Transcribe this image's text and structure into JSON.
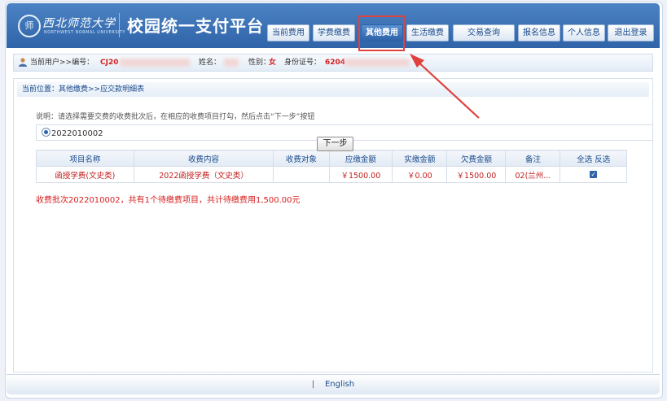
{
  "header": {
    "seal_char": "师",
    "school_name": "西北师范大学",
    "school_name_en": "NORTHWEST NORMAL UNIVERSITY",
    "system_title": "校园统一支付平台",
    "nav": [
      {
        "label": "当前费用",
        "active": false
      },
      {
        "label": "学费缴费",
        "active": false
      },
      {
        "label": "其他费用",
        "active": true
      },
      {
        "label": "生活缴费",
        "active": false
      },
      {
        "label": "交易查询",
        "active": false
      },
      {
        "label": "报名信息",
        "active": false
      },
      {
        "label": "个人信息",
        "active": false
      },
      {
        "label": "退出登录",
        "active": false
      }
    ]
  },
  "user_bar": {
    "prefix": "当前用户>>编号：",
    "id_value": "CJ20",
    "name_label": "姓名：",
    "gender_label": "性别：",
    "gender_value": "女",
    "id_card_label": "身份证号：",
    "id_card_value": "6204"
  },
  "breadcrumb": "当前位置：其他缴费>>应交款明细表",
  "instruction": "说明：请选择需要交费的收费批次后，在相应的收费项目打勾，然后点击“下一步”按钮",
  "batch": {
    "id": "2022010002",
    "selected": true
  },
  "table": {
    "headers": [
      "项目名称",
      "收费内容",
      "收费对象",
      "应缴金额",
      "实缴金额",
      "欠费金额",
      "备注",
      "全选 反选"
    ],
    "rows": [
      [
        "函授学费(文史类)",
        "2022函授学费（文史类）",
        "",
        "￥1500.00",
        "￥0.00",
        "￥1500.00",
        "02(兰州..."
      ]
    ],
    "row_checked": [
      true
    ]
  },
  "summary": "收费批次2022010002，共有1个待缴费项目，共计待缴费用1,500.00元",
  "next_button": "下一步",
  "footer": {
    "separator": "|",
    "language": "English"
  },
  "colors": {
    "header_blue": "#2f64a8",
    "highlight_red": "#e0413d",
    "warning_text": "#d61e1e"
  }
}
